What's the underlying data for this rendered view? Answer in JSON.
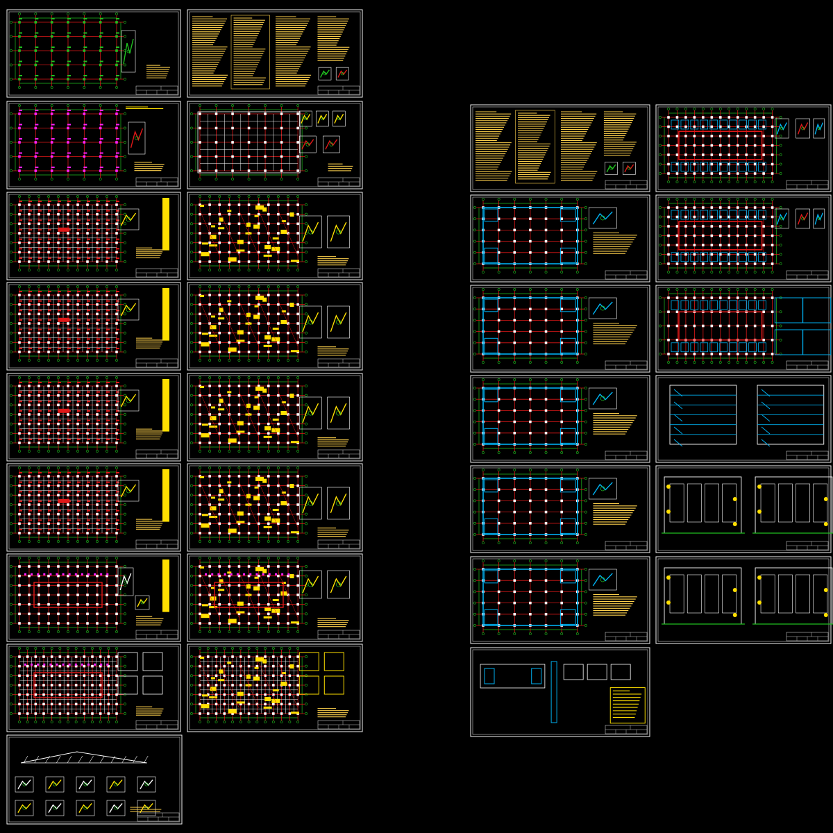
{
  "drawing_set": {
    "background": "#000000",
    "colors": {
      "frame": "#f2f2f2",
      "grid": "#e01818",
      "axis": "#20c020",
      "column": "#ffffff",
      "wall": "#00b0f0",
      "rebar": "#ffe000",
      "magenta": "#ff20ff",
      "text": "#ffd24d",
      "title_block": "#c8c8c8"
    }
  },
  "structural_sheets": [
    {
      "kind": "column-plan"
    },
    {
      "kind": "notes"
    },
    {
      "kind": "foundation-plan"
    },
    {
      "kind": "foundation-beams"
    },
    {
      "kind": "floor-plan"
    },
    {
      "kind": "rebar-plan"
    },
    {
      "kind": "floor-plan"
    },
    {
      "kind": "rebar-plan"
    },
    {
      "kind": "floor-plan"
    },
    {
      "kind": "rebar-plan"
    },
    {
      "kind": "floor-plan"
    },
    {
      "kind": "rebar-plan"
    },
    {
      "kind": "ring-plan"
    },
    {
      "kind": "ring-rebar-plan"
    },
    {
      "kind": "roof-plan"
    },
    {
      "kind": "roof-rebar-plan"
    },
    {
      "kind": "details"
    }
  ],
  "architectural_sheets": [
    {
      "kind": "notes"
    },
    {
      "kind": "arch-ring-plan"
    },
    {
      "kind": "arch-plan"
    },
    {
      "kind": "arch-ring-plan"
    },
    {
      "kind": "arch-plan"
    },
    {
      "kind": "arch-roof-plan"
    },
    {
      "kind": "arch-plan"
    },
    {
      "kind": "section"
    },
    {
      "kind": "arch-plan"
    },
    {
      "kind": "elevation"
    },
    {
      "kind": "arch-plan"
    },
    {
      "kind": "elevation"
    },
    {
      "kind": "arch-details"
    }
  ]
}
